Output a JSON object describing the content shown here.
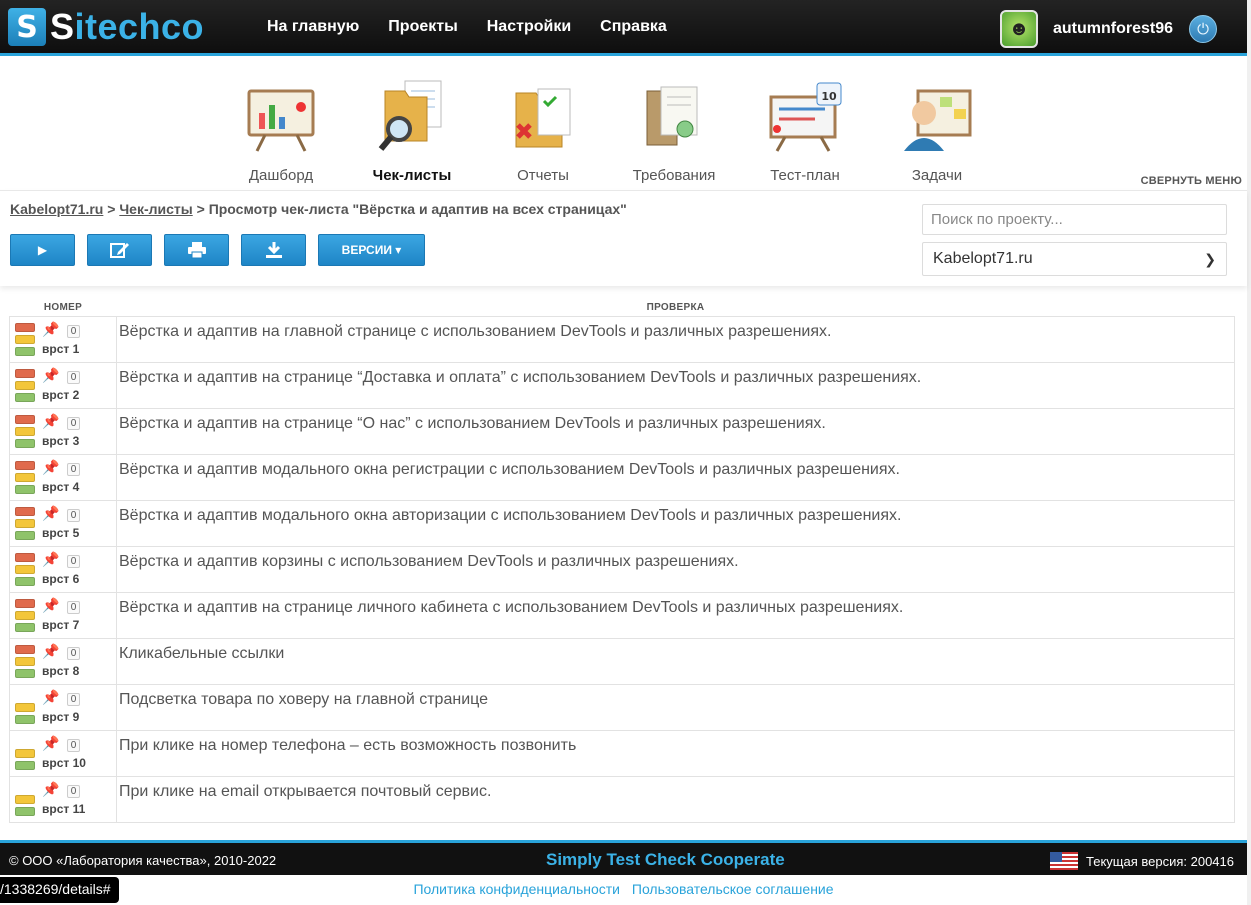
{
  "header": {
    "logo_text_s": "S",
    "logo_text_rest": "itechco",
    "nav": [
      "На главную",
      "Проекты",
      "Настройки",
      "Справка"
    ],
    "username": "autumnforest96"
  },
  "menu": {
    "items": [
      {
        "label": "Дашборд",
        "icon": "dashboard-icon"
      },
      {
        "label": "Чек-листы",
        "icon": "checklists-icon",
        "active": true
      },
      {
        "label": "Отчеты",
        "icon": "reports-icon"
      },
      {
        "label": "Требования",
        "icon": "requirements-icon"
      },
      {
        "label": "Тест-план",
        "icon": "test-plan-icon",
        "badge": "10"
      },
      {
        "label": "Задачи",
        "icon": "tasks-icon"
      }
    ],
    "collapse": "СВЕРНУТЬ МЕНЮ"
  },
  "breadcrumb": {
    "project": "Kabelopt71.ru",
    "sep1": " > ",
    "section": "Чек-листы",
    "sep2": " > ",
    "current": "Просмотр чек-листа \"Вёрстка и адаптив на всех страницах\""
  },
  "toolbar": {
    "versions_label": "ВЕРСИИ ▾"
  },
  "search": {
    "placeholder": "Поиск по проекту..."
  },
  "project_select": {
    "value": "Kabelopt71.ru"
  },
  "table": {
    "headers": {
      "num": "НОМЕР",
      "check": "ПРОВЕРКА"
    },
    "rows": [
      {
        "num": "врст 1",
        "count": "0",
        "flags": [
          "red",
          "yellow",
          "green"
        ],
        "text": "Вёрстка и адаптив на главной странице с использованием DevTools и различных разрешениях."
      },
      {
        "num": "врст 2",
        "count": "0",
        "flags": [
          "red",
          "yellow",
          "green"
        ],
        "text": "Вёрстка и адаптив на странице “Доставка и оплата” с использованием DevTools и различных разрешениях."
      },
      {
        "num": "врст 3",
        "count": "0",
        "flags": [
          "red",
          "yellow",
          "green"
        ],
        "text": "Вёрстка и адаптив на странице “О нас” с использованием DevTools и различных разрешениях."
      },
      {
        "num": "врст 4",
        "count": "0",
        "flags": [
          "red",
          "yellow",
          "green"
        ],
        "text": "Вёрстка и адаптив модального окна регистрации с использованием DevTools и различных разрешениях."
      },
      {
        "num": "врст 5",
        "count": "0",
        "flags": [
          "red",
          "yellow",
          "green"
        ],
        "text": "Вёрстка и адаптив модального окна авторизации с использованием DevTools и различных разрешениях."
      },
      {
        "num": "врст 6",
        "count": "0",
        "flags": [
          "red",
          "yellow",
          "green"
        ],
        "text": "Вёрстка и адаптив корзины с использованием DevTools и различных разрешениях."
      },
      {
        "num": "врст 7",
        "count": "0",
        "flags": [
          "red",
          "yellow",
          "green"
        ],
        "text": "Вёрстка и адаптив на странице личного кабинета с использованием DevTools и различных разрешениях."
      },
      {
        "num": "врст 8",
        "count": "0",
        "flags": [
          "red",
          "yellow",
          "green"
        ],
        "text": "Кликабельные ссылки"
      },
      {
        "num": "врст 9",
        "count": "0",
        "flags": [
          "yellow",
          "green"
        ],
        "text": "Подсветка товара по ховеру на главной странице"
      },
      {
        "num": "врст 10",
        "count": "0",
        "flags": [
          "yellow",
          "green"
        ],
        "text": "При клике на номер телефона – есть возможность позвонить"
      },
      {
        "num": "врст 11",
        "count": "0",
        "flags": [
          "yellow",
          "green"
        ],
        "text": "При клике на email открывается почтовый сервис."
      }
    ]
  },
  "footer": {
    "copyright": "© ООО «Лаборатория качества», 2010-2022",
    "slogan": "Simply Test Check Cooperate",
    "version": "Текущая версия: 200416",
    "privacy": "Политика конфиденциальности",
    "agreement": "Пользовательское соглашение",
    "status_url": "/1338269/details#"
  }
}
